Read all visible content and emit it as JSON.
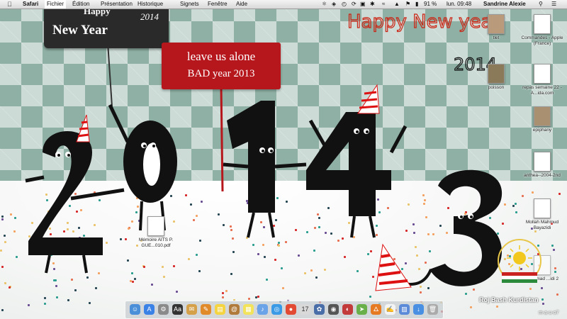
{
  "menubar": {
    "apple": "",
    "app": "Safari",
    "menus": [
      "Fichier",
      "Édition",
      "Présentation",
      "Historique",
      "Signets",
      "Fenêtre",
      "Aide"
    ],
    "battery": "91 %",
    "clock": "lun. 09:48",
    "user": "Sandrine Alexie"
  },
  "wallpaper": {
    "sign_happy": "Happy",
    "sign_year": "2014",
    "sign_newyear": "New Year",
    "banner_line1": "leave us alone",
    "banner_line2": "BAD year 2013",
    "scrawl": "Happy New year",
    "scrawl_year": "2014",
    "roj_text": "Roj Bash Kurdistan",
    "corner_tag": "m-a-u-o7"
  },
  "desktop_icons": [
    {
      "label": "tlet"
    },
    {
      "label": "Commandes - Apple (France)"
    },
    {
      "label": "poisson"
    },
    {
      "label": "repas semaine 22 - A...ida.com"
    },
    {
      "label": "epiphany"
    },
    {
      "label": "anthea--2004-2nd"
    },
    {
      "label": "Mollah Mahmud Bayazidi"
    },
    {
      "label": "Mémoire AITS P. GUE...010.pdf"
    },
    {
      "label": "...ammad ...idi 2"
    }
  ],
  "dock_apps": [
    "finder",
    "app-store",
    "system-preferences",
    "dictionary",
    "mail-stamp",
    "pages",
    "notes",
    "contacts",
    "stickies",
    "itunes",
    "safari",
    "chrome",
    "calendar",
    "iphoto",
    "aperture",
    "photo-booth",
    "maps",
    "firefox",
    "textedit",
    "preview",
    "downloads",
    "trash"
  ],
  "colors": {
    "banner": "#b5171d",
    "sign": "#2a2a2a",
    "numbers": "#111111"
  }
}
